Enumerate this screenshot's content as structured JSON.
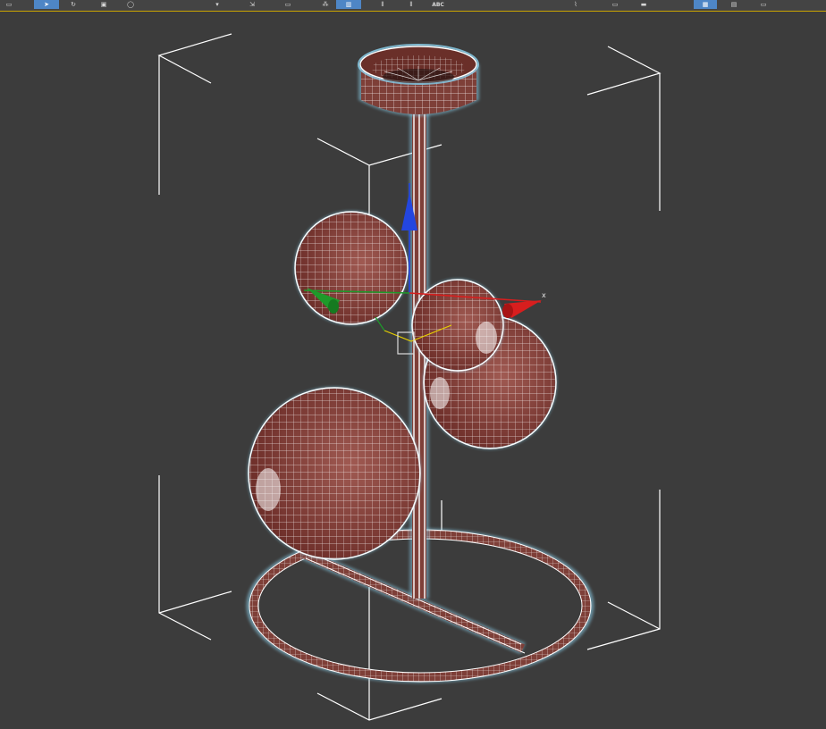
{
  "app": {
    "name": "3D modeling viewport"
  },
  "toolbar": {
    "buttons": [
      {
        "icon": "window-icon",
        "glyph": "▭"
      },
      {
        "icon": "select-arrow-icon",
        "glyph": "➤",
        "active": true
      },
      {
        "icon": "refresh-icon",
        "glyph": "↻"
      },
      {
        "icon": "region-select-icon",
        "glyph": "▣"
      },
      {
        "icon": "circle-icon",
        "glyph": "◯"
      },
      {
        "icon": "snap-icon",
        "glyph": "▾"
      },
      {
        "icon": "scale-icon",
        "glyph": "⇲"
      },
      {
        "icon": "rectangle-icon",
        "glyph": "▭"
      },
      {
        "icon": "snap-toggle-icon",
        "glyph": "⁂"
      },
      {
        "icon": "mirror-icon",
        "glyph": "▥",
        "active": true
      },
      {
        "icon": "align-icon",
        "glyph": "⫴"
      },
      {
        "icon": "align-tools-icon",
        "glyph": "⫴"
      },
      {
        "icon": "spellcheck-icon",
        "glyph": "ABC"
      },
      {
        "icon": "curve-editor-icon",
        "glyph": "⌇"
      },
      {
        "icon": "schematic-icon",
        "glyph": "▭"
      },
      {
        "icon": "material-editor-icon",
        "glyph": "▬"
      },
      {
        "icon": "render-setup-icon",
        "glyph": "▦",
        "active": true
      },
      {
        "icon": "render-frame-icon",
        "glyph": "▤"
      },
      {
        "icon": "render-icon",
        "glyph": "▭"
      }
    ],
    "accent_color": "#c8a400",
    "active_color": "#4e86c6"
  },
  "viewport": {
    "background": "#3c3c3c",
    "wire_color": "#ffffff",
    "mesh_color": "#8e4a42",
    "selection_glow": "#8fd6f2",
    "gizmo": {
      "x_label": "x",
      "x_color": "#d81e1e",
      "y_color": "#1e9a2a",
      "z_color": "#2346e0"
    }
  }
}
